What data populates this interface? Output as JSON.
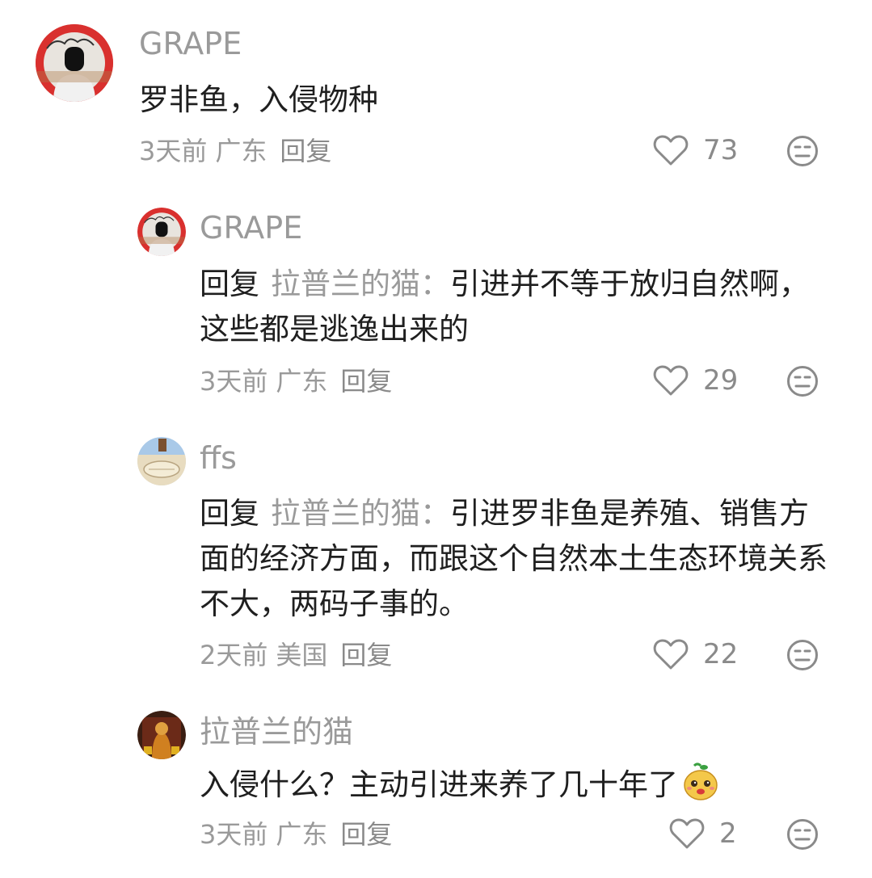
{
  "comments": [
    {
      "username": "GRAPE",
      "text": "罗非鱼，入侵物种",
      "time": "3天前",
      "location": "广东",
      "reply_label": "回复",
      "likes": "73"
    },
    {
      "username": "GRAPE",
      "reply_prefix": "回复",
      "mention": "拉普兰的猫：",
      "text": "引进并不等于放归自然啊，这些都是逃逸出来的",
      "time": "3天前",
      "location": "广东",
      "reply_label": "回复",
      "likes": "29"
    },
    {
      "username": "ffs",
      "reply_prefix": "回复",
      "mention": "拉普兰的猫：",
      "text": "引进罗非鱼是养殖、销售方面的经济方面，而跟这个自然本土生态环境关系不大，两码子事的。",
      "time": "2天前",
      "location": "美国",
      "reply_label": "回复",
      "likes": "22"
    },
    {
      "username": "拉普兰的猫",
      "text": "入侵什么？主动引进来养了几十年了",
      "time": "3天前",
      "location": "广东",
      "reply_label": "回复",
      "likes": "2"
    }
  ],
  "icons": {
    "like": "heart-outline-icon",
    "dislike": "neutral-face-icon",
    "emoji": "bean-face-emoji"
  },
  "colors": {
    "text": "#1f1f1f",
    "muted": "#9a9a9a",
    "icon": "#8a8a8a"
  }
}
